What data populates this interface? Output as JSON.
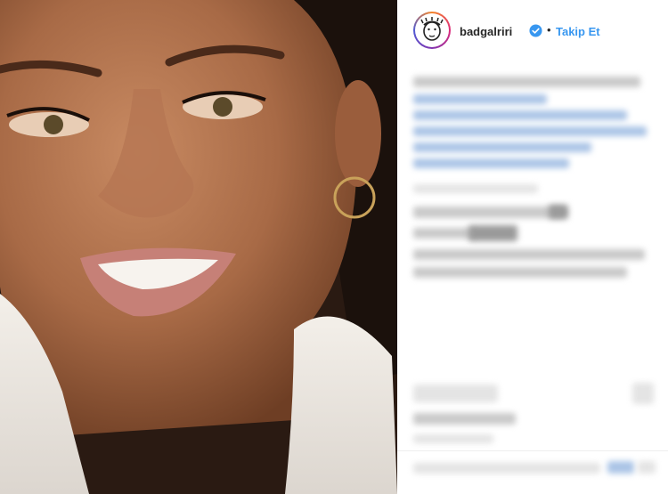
{
  "post": {
    "username": "badgalriri",
    "separator": "•",
    "follow_label": "Takip Et"
  },
  "colors": {
    "link": "#3897f0",
    "verified": "#3897f0",
    "text": "#262626"
  },
  "icons": [
    "verified-icon",
    "avatar-doodle",
    "more-options-icon"
  ]
}
